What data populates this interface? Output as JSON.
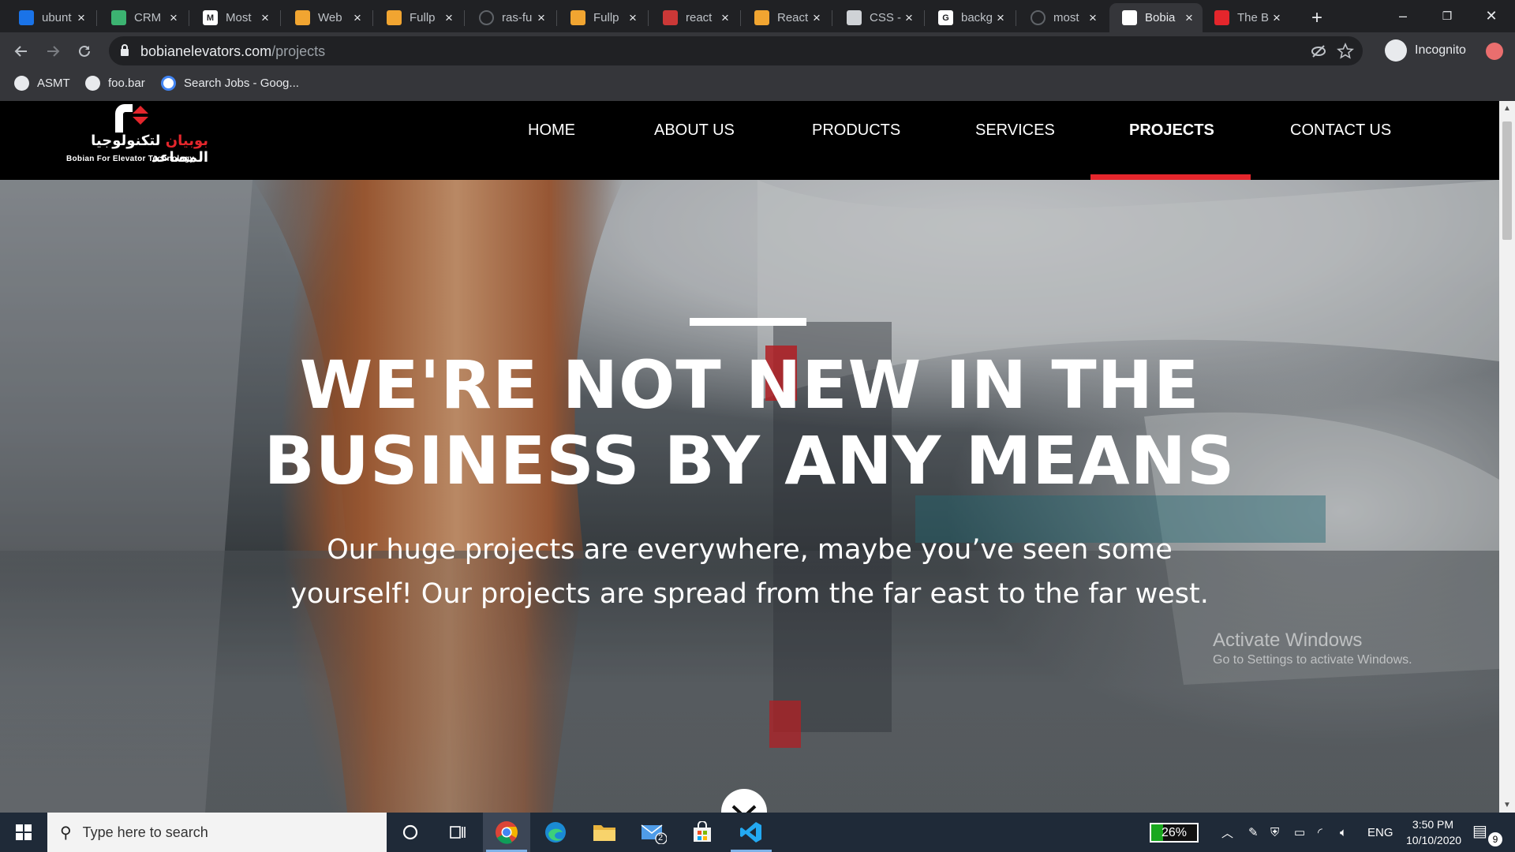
{
  "browser": {
    "tabs": [
      {
        "title": "ubunt",
        "favicon_color": "#1a73e8",
        "active": false
      },
      {
        "title": "CRM",
        "favicon_color": "#3cb371",
        "active": false
      },
      {
        "title": "Most",
        "favicon_color": "#ffffff",
        "favicon_letter": "M",
        "active": false
      },
      {
        "title": "Web",
        "favicon_color": "#f1a531",
        "active": false
      },
      {
        "title": "Fullp",
        "favicon_color": "#f1a531",
        "active": false
      },
      {
        "title": "ras-fu",
        "favicon_color": "#202124",
        "active": false
      },
      {
        "title": "Fullp",
        "favicon_color": "#f1a531",
        "active": false
      },
      {
        "title": "react",
        "favicon_color": "#cb3837",
        "active": false
      },
      {
        "title": "React",
        "favicon_color": "#f1a531",
        "active": false
      },
      {
        "title": "CSS -",
        "favicon_color": "#cfd2d6",
        "active": false
      },
      {
        "title": "backg",
        "favicon_color": "#ffffff",
        "favicon_letter": "G",
        "active": false
      },
      {
        "title": "most",
        "favicon_color": "#202124",
        "active": false
      },
      {
        "title": "Bobia",
        "favicon_color": "#ffffff",
        "active": true
      },
      {
        "title": "The B",
        "favicon_color": "#e4262c",
        "active": false
      }
    ],
    "close_glyph": "×",
    "new_tab_glyph": "+",
    "window_controls": {
      "minimize": "–",
      "restore": "❐",
      "close": "✕"
    },
    "url": {
      "host": "bobianelevators.com",
      "path": "/projects"
    },
    "incognito_label": "Incognito",
    "bookmarks": [
      "ASMT",
      "foo.bar",
      "Search Jobs - Goog..."
    ]
  },
  "site": {
    "logo": {
      "arabic_red": "بوبيان",
      "arabic_white": " لتكنولوجيا المصاعد",
      "english": "Bobian For Elevator Technology"
    },
    "nav": [
      "HOME",
      "ABOUT US",
      "PRODUCTS",
      "SERVICES",
      "PROJECTS",
      "CONTACT US"
    ],
    "active_nav": "PROJECTS",
    "accent_color": "#e4262c",
    "hero": {
      "title_line1": "WE'RE NOT NEW IN THE",
      "title_line2": "BUSINESS BY ANY MEANS",
      "subtitle_line1": "Our huge projects are everywhere, maybe you’ve seen some",
      "subtitle_line2": "yourself! Our projects are spread from the far east to the far west."
    }
  },
  "windows": {
    "watermark_title": "Activate Windows",
    "watermark_sub": "Go to Settings to activate Windows.",
    "search_placeholder": "Type here to search",
    "battery_percent": "26%",
    "battery_level": 0.26,
    "language": "ENG",
    "time": "3:50 PM",
    "date": "10/10/2020",
    "mail_badge": "2",
    "notification_count": "9"
  }
}
